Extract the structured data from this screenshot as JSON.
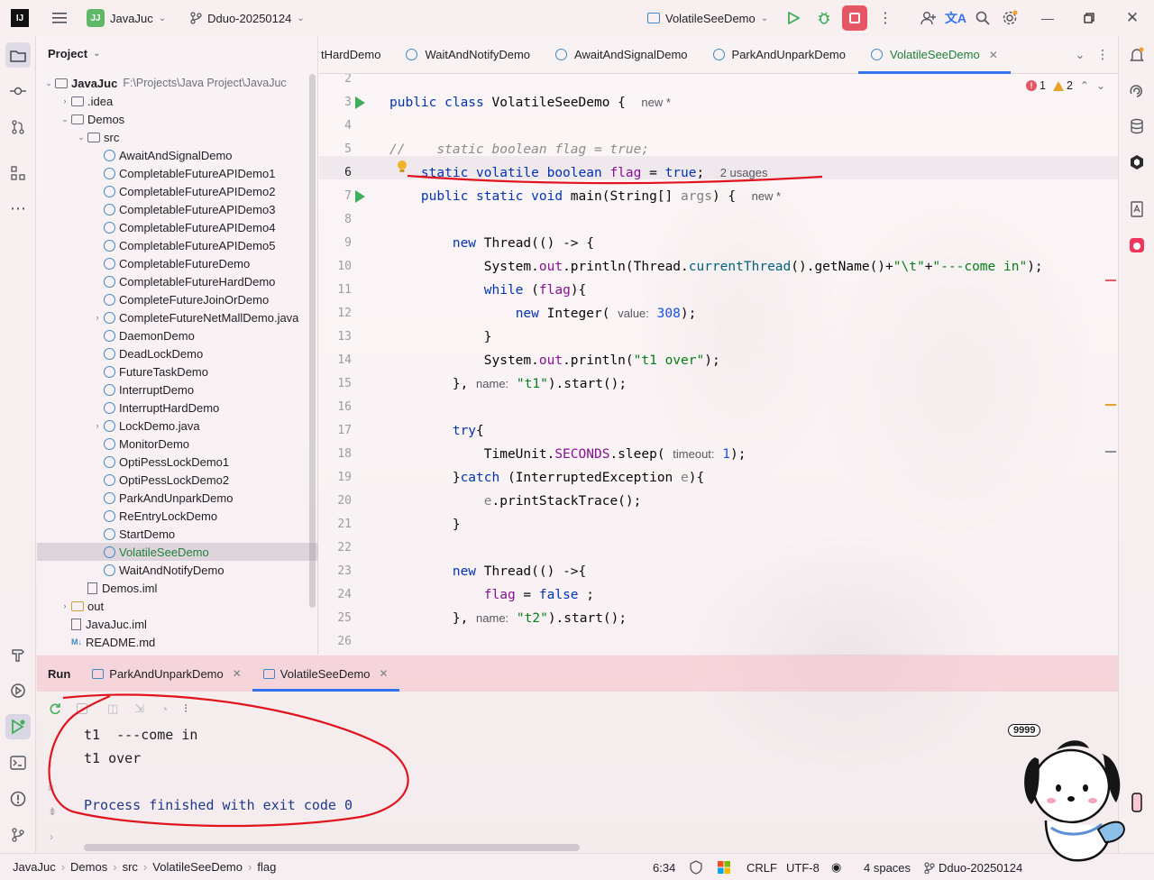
{
  "titlebar": {
    "project_badge": "JJ",
    "project_name": "JavaJuc",
    "branch": "Dduo-20250124",
    "run_config": "VolatileSeeDemo"
  },
  "project_panel": {
    "title": "Project",
    "root": {
      "name": "JavaJuc",
      "path": "F:\\Projects\\Java Project\\JavaJuc"
    },
    "items": [
      {
        "label": ".idea",
        "depth": 1,
        "kind": "folder",
        "arrow": "›"
      },
      {
        "label": "Demos",
        "depth": 1,
        "kind": "folder",
        "arrow": "⌄"
      },
      {
        "label": "src",
        "depth": 2,
        "kind": "folder",
        "arrow": "⌄"
      },
      {
        "label": "AwaitAndSignalDemo",
        "depth": 3,
        "kind": "class"
      },
      {
        "label": "CompletableFutureAPIDemo1",
        "depth": 3,
        "kind": "class"
      },
      {
        "label": "CompletableFutureAPIDemo2",
        "depth": 3,
        "kind": "class"
      },
      {
        "label": "CompletableFutureAPIDemo3",
        "depth": 3,
        "kind": "class"
      },
      {
        "label": "CompletableFutureAPIDemo4",
        "depth": 3,
        "kind": "class"
      },
      {
        "label": "CompletableFutureAPIDemo5",
        "depth": 3,
        "kind": "class"
      },
      {
        "label": "CompletableFutureDemo",
        "depth": 3,
        "kind": "class"
      },
      {
        "label": "CompletableFutureHardDemo",
        "depth": 3,
        "kind": "class"
      },
      {
        "label": "CompleteFutureJoinOrDemo",
        "depth": 3,
        "kind": "class"
      },
      {
        "label": "CompleteFutureNetMallDemo.java",
        "depth": 3,
        "kind": "class",
        "arrow": "›"
      },
      {
        "label": "DaemonDemo",
        "depth": 3,
        "kind": "class"
      },
      {
        "label": "DeadLockDemo",
        "depth": 3,
        "kind": "class"
      },
      {
        "label": "FutureTaskDemo",
        "depth": 3,
        "kind": "class"
      },
      {
        "label": "InterruptDemo",
        "depth": 3,
        "kind": "class"
      },
      {
        "label": "InterruptHardDemo",
        "depth": 3,
        "kind": "class"
      },
      {
        "label": "LockDemo.java",
        "depth": 3,
        "kind": "class",
        "arrow": "›"
      },
      {
        "label": "MonitorDemo",
        "depth": 3,
        "kind": "class"
      },
      {
        "label": "OptiPessLockDemo1",
        "depth": 3,
        "kind": "class"
      },
      {
        "label": "OptiPessLockDemo2",
        "depth": 3,
        "kind": "class"
      },
      {
        "label": "ParkAndUnparkDemo",
        "depth": 3,
        "kind": "class"
      },
      {
        "label": "ReEntryLockDemo",
        "depth": 3,
        "kind": "class"
      },
      {
        "label": "StartDemo",
        "depth": 3,
        "kind": "class"
      },
      {
        "label": "VolatileSeeDemo",
        "depth": 3,
        "kind": "class",
        "selected": true
      },
      {
        "label": "WaitAndNotifyDemo",
        "depth": 3,
        "kind": "class"
      },
      {
        "label": "Demos.iml",
        "depth": 2,
        "kind": "file"
      },
      {
        "label": "out",
        "depth": 1,
        "kind": "folder-yellow",
        "arrow": "›"
      },
      {
        "label": "JavaJuc.iml",
        "depth": 1,
        "kind": "file"
      },
      {
        "label": "README.md",
        "depth": 1,
        "kind": "md"
      }
    ]
  },
  "editor_tabs": [
    {
      "label": "tHardDemo",
      "active": false
    },
    {
      "label": "WaitAndNotifyDemo",
      "active": false
    },
    {
      "label": "AwaitAndSignalDemo",
      "active": false
    },
    {
      "label": "ParkAndUnparkDemo",
      "active": false
    },
    {
      "label": "VolatileSeeDemo",
      "active": true
    }
  ],
  "inspections": {
    "errors": "1",
    "warnings": "2"
  },
  "code": [
    {
      "n": "2",
      "html": ""
    },
    {
      "n": "3",
      "html": "<span class='kw'>public class</span> VolatileSeeDemo {  <span class='hint'>new *</span>",
      "run": true
    },
    {
      "n": "4",
      "html": ""
    },
    {
      "n": "5",
      "html": "<span class='cm'>//    static boolean flag = true;</span>"
    },
    {
      "n": "6",
      "html": "    <span class='kw'>static volatile boolean</span> <span class='fld'>flag</span> = <span class='kw'>true</span>;  <span class='hint'>2 usages</span>",
      "current": true
    },
    {
      "n": "7",
      "html": "    <span class='kw'>public static void</span> main(String[] <span style='color:#808080'>args</span>) {  <span class='hint'>new *</span>",
      "run": true
    },
    {
      "n": "8",
      "html": ""
    },
    {
      "n": "9",
      "html": "        <span class='kw'>new</span> Thread(() -> {"
    },
    {
      "n": "10",
      "html": "            System.<span class='fld'>out</span>.println(Thread.<span style='color:#00627a'>currentThread</span>().getName()+<span class='str'>\"\\t\"</span>+<span class='str'>\"---come in\"</span>);"
    },
    {
      "n": "11",
      "html": "            <span class='kw'>while</span> (<span class='fld'>flag</span>){"
    },
    {
      "n": "12",
      "html": "                <span class='kw'>new</span> Integer( <span class='paramhint'>value:</span> <span class='num'>308</span>);"
    },
    {
      "n": "13",
      "html": "            }"
    },
    {
      "n": "14",
      "html": "            System.<span class='fld'>out</span>.println(<span class='str'>\"t1 over\"</span>);"
    },
    {
      "n": "15",
      "html": "        }, <span class='paramhint'>name:</span> <span class='str'>\"t1\"</span>).start();"
    },
    {
      "n": "16",
      "html": ""
    },
    {
      "n": "17",
      "html": "        <span class='kw'>try</span>{"
    },
    {
      "n": "18",
      "html": "            TimeUnit.<span class='fld'>SECONDS</span>.sleep( <span class='paramhint'>timeout:</span> <span class='num'>1</span>);"
    },
    {
      "n": "19",
      "html": "        }<span class='kw'>catch</span> (InterruptedException <span style='color:#808080'>e</span>){"
    },
    {
      "n": "20",
      "html": "            <span style='color:#808080'>e</span>.printStackTrace();"
    },
    {
      "n": "21",
      "html": "        }"
    },
    {
      "n": "22",
      "html": ""
    },
    {
      "n": "23",
      "html": "        <span class='kw'>new</span> Thread(() ->{"
    },
    {
      "n": "24",
      "html": "            <span class='fld'>flag</span> = <span class='kw'>false</span> ;"
    },
    {
      "n": "25",
      "html": "        }, <span class='paramhint'>name:</span> <span class='str'>\"t2\"</span>).start();"
    },
    {
      "n": "26",
      "html": ""
    }
  ],
  "run_panel": {
    "title": "Run",
    "tabs": [
      {
        "label": "ParkAndUnparkDemo",
        "active": false
      },
      {
        "label": "VolatileSeeDemo",
        "active": true
      }
    ],
    "console": [
      "t1  ---come in",
      "t1 over",
      "",
      "Process finished with exit code 0"
    ]
  },
  "statusbar": {
    "breadcrumb": [
      "JavaJuc",
      "Demos",
      "src",
      "VolatileSeeDemo",
      "flag"
    ],
    "position": "6:34",
    "line_sep": "CRLF",
    "encoding": "UTF-8",
    "indent": "4 spaces",
    "branch": "Dduo-20250124"
  },
  "mascot_badge": "9999",
  "colors": {
    "accent": "#3574f0",
    "run_green": "#3fae5a",
    "stop_red": "#e55765",
    "annotation_red": "#e0141e"
  }
}
